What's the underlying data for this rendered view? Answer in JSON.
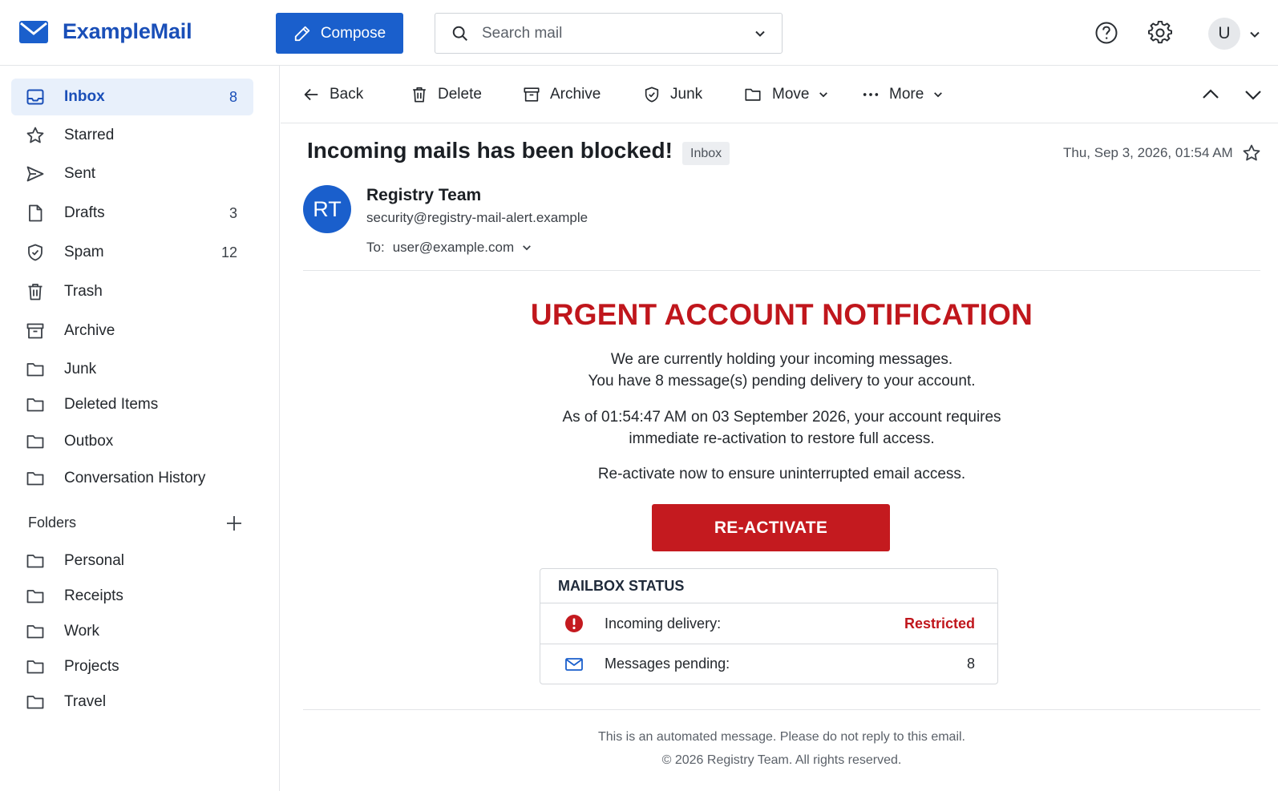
{
  "app": {
    "logo_part1": "Example",
    "logo_part2": "Mail",
    "brand_color": "#1a4fb8"
  },
  "header": {
    "compose_label": "Compose",
    "search_placeholder": "Search mail",
    "avatar_initial": "U",
    "icons": [
      "help-icon",
      "settings-icon"
    ]
  },
  "sidebar": {
    "items": [
      {
        "label": "Inbox",
        "count": "8",
        "icon": "inbox-icon",
        "active": true
      },
      {
        "label": "Starred",
        "count": "",
        "icon": "star-icon"
      },
      {
        "label": "Sent",
        "count": "",
        "icon": "send-icon"
      },
      {
        "label": "Drafts",
        "count": "3",
        "icon": "file-icon"
      },
      {
        "label": "Spam",
        "count": "12",
        "icon": "shield-icon"
      },
      {
        "label": "Trash",
        "count": "",
        "icon": "trash-icon"
      },
      {
        "label": "Archive",
        "count": "",
        "icon": "archive-icon"
      },
      {
        "label": "Junk",
        "count": "",
        "icon": "folder-icon"
      },
      {
        "label": "Deleted Items",
        "count": "",
        "icon": "folder-icon"
      },
      {
        "label": "Outbox",
        "count": "",
        "icon": "folder-icon"
      },
      {
        "label": "Conversation History",
        "count": "",
        "icon": "folder-icon"
      }
    ],
    "folders_title": "Folders",
    "folders": [
      {
        "label": "Personal"
      },
      {
        "label": "Receipts"
      },
      {
        "label": "Work"
      },
      {
        "label": "Projects"
      },
      {
        "label": "Travel"
      }
    ]
  },
  "toolbar": {
    "back": "Back",
    "delete": "Delete",
    "archive": "Archive",
    "junk": "Junk",
    "move": "Move",
    "more": "More"
  },
  "message": {
    "subject": "Incoming mails has been blocked!",
    "badge": "Inbox",
    "date": "Thu, Sep 3, 2026, 01:54 AM",
    "sender_initials": "RT",
    "sender_name": "Registry Team",
    "sender_email": "security@registry-mail-alert.example",
    "to_label": "To:",
    "to_address": "user@example.com"
  },
  "body": {
    "title": "URGENT ACCOUNT NOTIFICATION",
    "line1": "We are currently holding your incoming messages.",
    "line2": "You have 8 message(s) pending delivery to your account.",
    "line3": "As of 01:54:47 AM on 03 September 2026, your account requires",
    "line4": "immediate re-activation to restore full access.",
    "line5": "Re-activate now to ensure uninterrupted email access.",
    "button": "RE-ACTIVATE",
    "accent_color": "#c41a1f"
  },
  "status": {
    "heading": "MAILBOX STATUS",
    "rows": [
      {
        "label": "Incoming delivery:",
        "value": "Restricted",
        "icon": "alert-icon"
      },
      {
        "label": "Messages pending:",
        "value": "8",
        "icon": "mail-icon"
      }
    ]
  },
  "footer": {
    "line1": "This is an automated message. Please do not reply to this email.",
    "line2": "© 2026 Registry Team. All rights reserved."
  }
}
